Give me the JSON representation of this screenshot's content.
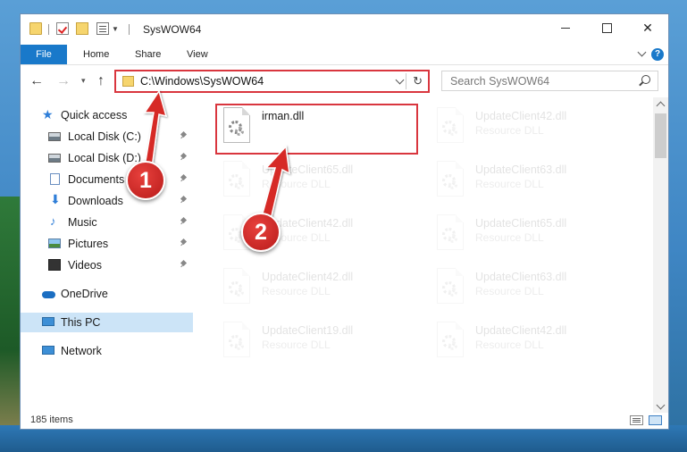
{
  "window": {
    "title": "SysWOW64",
    "controls": {
      "minimize": "minimize",
      "maximize": "maximize",
      "close": "✕"
    }
  },
  "ribbon": {
    "tabs": [
      "File",
      "Home",
      "Share",
      "View"
    ],
    "help": "?"
  },
  "nav": {
    "back": "←",
    "forward": "→",
    "recent": "▾",
    "up": "↑",
    "address": "C:\\Windows\\SysWOW64",
    "refresh": "↻",
    "search_placeholder": "Search SysWOW64"
  },
  "sidebar": {
    "items": [
      {
        "label": "Quick access",
        "icon": "star-icon",
        "pinned": false
      },
      {
        "label": "Local Disk (C:)",
        "icon": "drive-icon",
        "pinned": true
      },
      {
        "label": "Local Disk (D:)",
        "icon": "drive-icon",
        "pinned": true
      },
      {
        "label": "Documents",
        "icon": "documents-icon",
        "pinned": true
      },
      {
        "label": "Downloads",
        "icon": "download-icon",
        "pinned": true
      },
      {
        "label": "Music",
        "icon": "music-icon",
        "pinned": true
      },
      {
        "label": "Pictures",
        "icon": "pictures-icon",
        "pinned": true
      },
      {
        "label": "Videos",
        "icon": "videos-icon",
        "pinned": true
      },
      {
        "label": "OneDrive",
        "icon": "cloud-icon",
        "pinned": false
      },
      {
        "label": "This PC",
        "icon": "computer-icon",
        "pinned": false,
        "selected": true
      },
      {
        "label": "Network",
        "icon": "network-icon",
        "pinned": false
      }
    ]
  },
  "files": [
    {
      "name": "irman.dll",
      "type": "",
      "highlighted": true
    },
    {
      "name": "UpdateClient42.dll",
      "type": "Resource DLL"
    },
    {
      "name": "UpdateClient65.dll",
      "type": "Resource DLL"
    },
    {
      "name": "UpdateClient63.dll",
      "type": "Resource DLL"
    },
    {
      "name": "UpdateClient42.dll",
      "type": "Resource DLL"
    },
    {
      "name": "UpdateClient65.dll",
      "type": "Resource DLL"
    },
    {
      "name": "UpdateClient42.dll",
      "type": "Resource DLL"
    },
    {
      "name": "UpdateClient63.dll",
      "type": "Resource DLL"
    },
    {
      "name": "UpdateClient19.dll",
      "type": "Resource DLL"
    },
    {
      "name": "UpdateClient42.dll",
      "type": "Resource DLL"
    }
  ],
  "status": {
    "items_count": "185 items"
  },
  "callouts": {
    "step1": "1",
    "step2": "2"
  },
  "colors": {
    "accent": "#1979ca",
    "highlight": "#d9363e",
    "callout": "#d62b28",
    "selection": "#cce4f7"
  }
}
